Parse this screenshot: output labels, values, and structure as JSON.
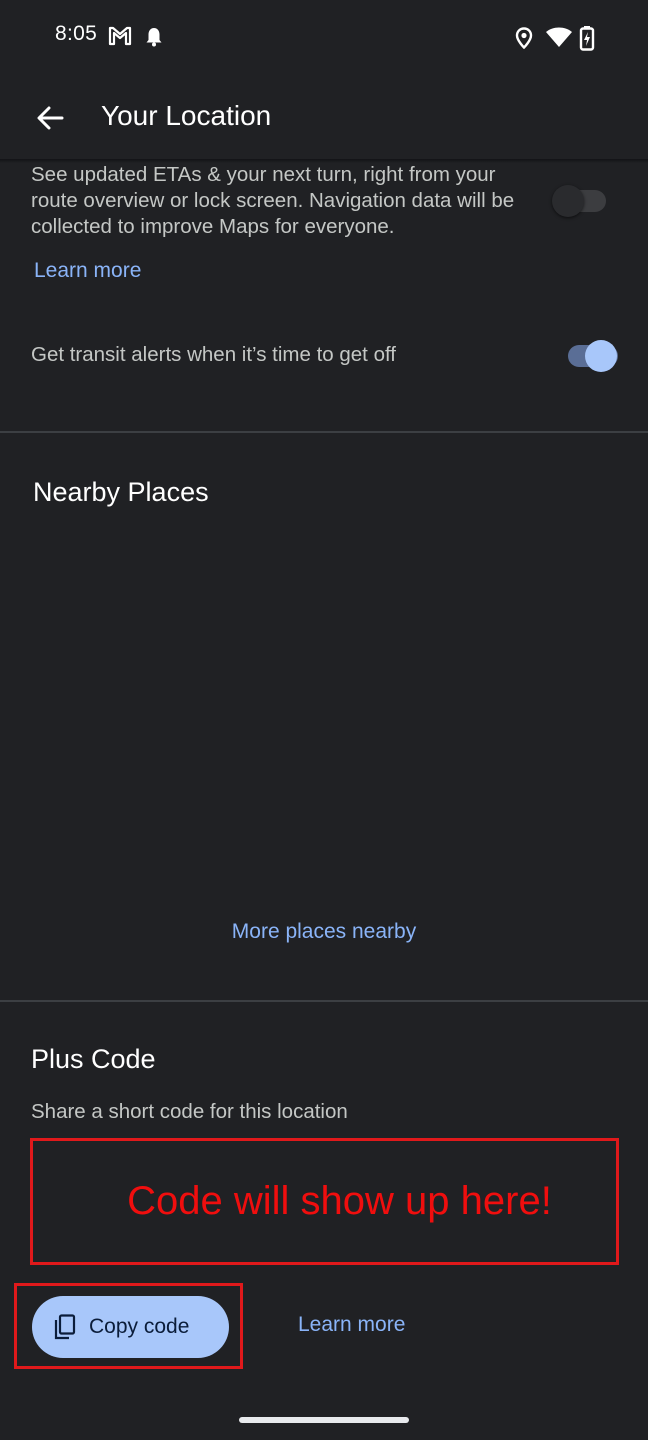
{
  "status_bar": {
    "time": "8:05",
    "left_icons": [
      "gmail-icon",
      "notification-bell-icon"
    ],
    "right_icons": [
      "location-pin-icon",
      "wifi-icon",
      "battery-charging-icon"
    ]
  },
  "app_bar": {
    "back_icon": "arrow-back-icon",
    "title": "Your Location"
  },
  "navigation_updates": {
    "description": "See updated ETAs & your next turn, right from your route overview or lock screen. Navigation data will be collected to improve Maps for everyone.",
    "learn_more": "Learn more",
    "toggle_on": false
  },
  "transit_alerts": {
    "label": "Get transit alerts when it’s time to get off",
    "toggle_on": true
  },
  "nearby_places": {
    "title": "Nearby Places",
    "more_link": "More places nearby"
  },
  "plus_code": {
    "title": "Plus Code",
    "description": "Share a short code for this location",
    "annotation": "Code will show up here!",
    "copy_button": "Copy code",
    "copy_icon": "copy-icon",
    "learn_more": "Learn more"
  },
  "colors": {
    "background": "#202124",
    "link": "#8ab4f8",
    "button": "#a8c7fa",
    "annotation": "#e0191b"
  }
}
